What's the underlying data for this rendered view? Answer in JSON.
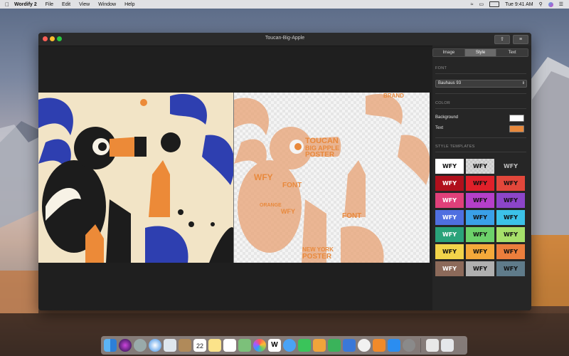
{
  "menubar": {
    "app_name": "Wordify 2",
    "menus": [
      "File",
      "Edit",
      "View",
      "Window",
      "Help"
    ],
    "clock": "Tue 9:41 AM"
  },
  "window": {
    "title": "Toucan-Big-Apple"
  },
  "tabs": [
    {
      "label": "Image",
      "active": false
    },
    {
      "label": "Style",
      "active": true
    },
    {
      "label": "Text",
      "active": false
    }
  ],
  "font": {
    "section_label": "FONT",
    "selected": "Bauhaus 93"
  },
  "color": {
    "section_label": "COLOR",
    "background_label": "Background",
    "background_value": "#ffffff",
    "text_label": "Text",
    "text_value": "#e8893c"
  },
  "templates": {
    "section_label": "STYLE TEMPLATES",
    "items": [
      {
        "label": "WFY",
        "bg": "#ffffff",
        "fg": "#111111"
      },
      {
        "label": "WFY",
        "bg": "#d8d8d8",
        "fg": "#111111"
      },
      {
        "label": "WFY",
        "bg": "#262626",
        "fg": "#bdbdbd"
      },
      {
        "label": "WFY",
        "bg": "#b0101c",
        "fg": "#ffffff"
      },
      {
        "label": "WFY",
        "bg": "#e0202a",
        "fg": "#111111"
      },
      {
        "label": "WFY",
        "bg": "#e2473b",
        "fg": "#111111"
      },
      {
        "label": "WFY",
        "bg": "#e0407a",
        "fg": "#ffffff"
      },
      {
        "label": "WFY",
        "bg": "#b53fc9",
        "fg": "#111111"
      },
      {
        "label": "WFY",
        "bg": "#8c45c9",
        "fg": "#111111"
      },
      {
        "label": "WFY",
        "bg": "#4f6fe0",
        "fg": "#ffffff"
      },
      {
        "label": "WFY",
        "bg": "#3aa0e8",
        "fg": "#111111"
      },
      {
        "label": "WFY",
        "bg": "#3cc2e8",
        "fg": "#111111"
      },
      {
        "label": "WFY",
        "bg": "#2aa37a",
        "fg": "#ffffff"
      },
      {
        "label": "WFY",
        "bg": "#6cd16a",
        "fg": "#111111"
      },
      {
        "label": "WFY",
        "bg": "#a6e06a",
        "fg": "#111111"
      },
      {
        "label": "WFY",
        "bg": "#f2d44a",
        "fg": "#111111"
      },
      {
        "label": "WFY",
        "bg": "#f4a93a",
        "fg": "#111111"
      },
      {
        "label": "WFY",
        "bg": "#ec7e3c",
        "fg": "#111111"
      },
      {
        "label": "WFY",
        "bg": "#8c6a5a",
        "fg": "#ffffff"
      },
      {
        "label": "WFY",
        "bg": "#b0b0b0",
        "fg": "#111111"
      },
      {
        "label": "WFY",
        "bg": "#5f7b8a",
        "fg": "#111111"
      }
    ]
  },
  "wordart": {
    "color": "#e8893c",
    "words": [
      "TOUCAN",
      "BIG APPLE",
      "POSTER",
      "WFY",
      "BRAND",
      "FONT",
      "NEW YORK",
      "ORANGE"
    ]
  },
  "dock": {
    "calendar_day": "22"
  }
}
